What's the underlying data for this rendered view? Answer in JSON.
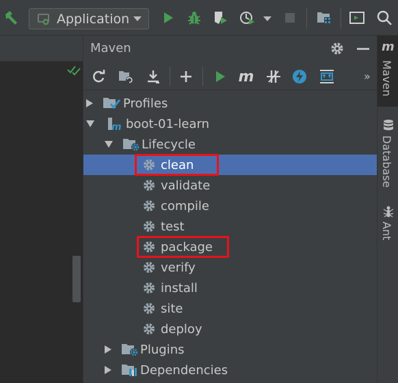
{
  "toolbar": {
    "run_config_label": "Application",
    "icons": [
      "build-hammer-icon",
      "run-icon",
      "debug-icon",
      "coverage-icon",
      "profile-icon",
      "stop-icon",
      "project-structure-icon",
      "layout-icon",
      "search-icon"
    ]
  },
  "maven": {
    "title": "Maven",
    "toolbar_icons": [
      "reload-icon",
      "generate-sources-icon",
      "download-icon",
      "add-icon",
      "run-maven-icon",
      "execute-goal-icon",
      "toggle-offline-icon",
      "skip-tests-icon",
      "show-diagram-icon",
      "more-icon"
    ],
    "tree": {
      "profiles": "Profiles",
      "project": "boot-01-learn",
      "lifecycle": "Lifecycle",
      "goals": [
        "clean",
        "validate",
        "compile",
        "test",
        "package",
        "verify",
        "install",
        "site",
        "deploy"
      ],
      "selected_goal": "clean",
      "highlighted_goals": [
        "clean",
        "package"
      ],
      "plugins": "Plugins",
      "dependencies": "Dependencies"
    }
  },
  "side_tabs": {
    "maven": "Maven",
    "database": "Database",
    "ant": "Ant"
  },
  "colors": {
    "selection": "#4b6eaf",
    "highlight_box": "#e8131a",
    "run_green": "#499c54",
    "accent_blue": "#3592c4"
  }
}
